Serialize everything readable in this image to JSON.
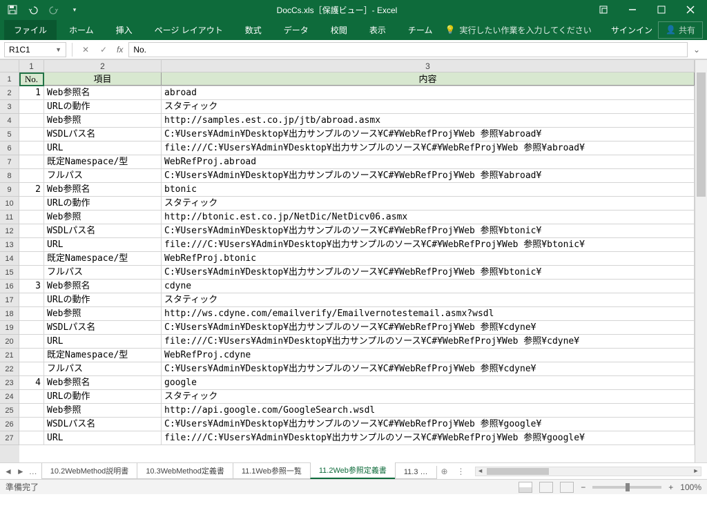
{
  "title": "DocCs.xls［保護ビュー］- Excel",
  "qat": {
    "save": "save",
    "undo": "undo",
    "redo": "redo"
  },
  "tabs": {
    "file": "ファイル",
    "home": "ホーム",
    "insert": "挿入",
    "pagelayout": "ページ レイアウト",
    "formulas": "数式",
    "data": "データ",
    "review": "校閲",
    "view": "表示",
    "team": "チーム"
  },
  "tellme": "実行したい作業を入力してください",
  "signin": "サインイン",
  "share": "共有",
  "namebox": "R1C1",
  "formula": "No.",
  "colHeaders": [
    "1",
    "2",
    "3"
  ],
  "headerRow": {
    "c1": "No.",
    "c2": "項目",
    "c3": "内容"
  },
  "rows": [
    {
      "n": "1",
      "c1": "1",
      "c2": "Web参照名",
      "c3": "abroad"
    },
    {
      "n": "2",
      "c1": "",
      "c2": "URLの動作",
      "c3": "スタティック"
    },
    {
      "n": "3",
      "c1": "",
      "c2": "Web参照",
      "c3": "http://samples.est.co.jp/jtb/abroad.asmx"
    },
    {
      "n": "4",
      "c1": "",
      "c2": "WSDLパス名",
      "c3": "C:¥Users¥Admin¥Desktop¥出力サンプルのソース¥C#¥WebRefProj¥Web 参照¥abroad¥"
    },
    {
      "n": "5",
      "c1": "",
      "c2": "URL",
      "c3": "file:///C:¥Users¥Admin¥Desktop¥出力サンプルのソース¥C#¥WebRefProj¥Web 参照¥abroad¥"
    },
    {
      "n": "6",
      "c1": "",
      "c2": "既定Namespace/型",
      "c3": "WebRefProj.abroad"
    },
    {
      "n": "7",
      "c1": "",
      "c2": "フルパス",
      "c3": "C:¥Users¥Admin¥Desktop¥出力サンプルのソース¥C#¥WebRefProj¥Web 参照¥abroad¥"
    },
    {
      "n": "8",
      "c1": "2",
      "c2": "Web参照名",
      "c3": "btonic"
    },
    {
      "n": "9",
      "c1": "",
      "c2": "URLの動作",
      "c3": "スタティック"
    },
    {
      "n": "10",
      "c1": "",
      "c2": "Web参照",
      "c3": "http://btonic.est.co.jp/NetDic/NetDicv06.asmx"
    },
    {
      "n": "11",
      "c1": "",
      "c2": "WSDLパス名",
      "c3": "C:¥Users¥Admin¥Desktop¥出力サンプルのソース¥C#¥WebRefProj¥Web 参照¥btonic¥"
    },
    {
      "n": "12",
      "c1": "",
      "c2": "URL",
      "c3": "file:///C:¥Users¥Admin¥Desktop¥出力サンプルのソース¥C#¥WebRefProj¥Web 参照¥btonic¥"
    },
    {
      "n": "13",
      "c1": "",
      "c2": "既定Namespace/型",
      "c3": "WebRefProj.btonic"
    },
    {
      "n": "14",
      "c1": "",
      "c2": "フルパス",
      "c3": "C:¥Users¥Admin¥Desktop¥出力サンプルのソース¥C#¥WebRefProj¥Web 参照¥btonic¥"
    },
    {
      "n": "15",
      "c1": "3",
      "c2": "Web参照名",
      "c3": "cdyne"
    },
    {
      "n": "16",
      "c1": "",
      "c2": "URLの動作",
      "c3": "スタティック"
    },
    {
      "n": "17",
      "c1": "",
      "c2": "Web参照",
      "c3": "http://ws.cdyne.com/emailverify/Emailvernotestemail.asmx?wsdl"
    },
    {
      "n": "18",
      "c1": "",
      "c2": "WSDLパス名",
      "c3": "C:¥Users¥Admin¥Desktop¥出力サンプルのソース¥C#¥WebRefProj¥Web 参照¥cdyne¥"
    },
    {
      "n": "19",
      "c1": "",
      "c2": "URL",
      "c3": "file:///C:¥Users¥Admin¥Desktop¥出力サンプルのソース¥C#¥WebRefProj¥Web 参照¥cdyne¥"
    },
    {
      "n": "20",
      "c1": "",
      "c2": "既定Namespace/型",
      "c3": "WebRefProj.cdyne"
    },
    {
      "n": "21",
      "c1": "",
      "c2": "フルパス",
      "c3": "C:¥Users¥Admin¥Desktop¥出力サンプルのソース¥C#¥WebRefProj¥Web 参照¥cdyne¥"
    },
    {
      "n": "22",
      "c1": "4",
      "c2": "Web参照名",
      "c3": "google"
    },
    {
      "n": "23",
      "c1": "",
      "c2": "URLの動作",
      "c3": "スタティック"
    },
    {
      "n": "24",
      "c1": "",
      "c2": "Web参照",
      "c3": "http://api.google.com/GoogleSearch.wsdl"
    },
    {
      "n": "25",
      "c1": "",
      "c2": "WSDLパス名",
      "c3": "C:¥Users¥Admin¥Desktop¥出力サンプルのソース¥C#¥WebRefProj¥Web 参照¥google¥"
    },
    {
      "n": "26",
      "c1": "",
      "c2": "URL",
      "c3": "file:///C:¥Users¥Admin¥Desktop¥出力サンプルのソース¥C#¥WebRefProj¥Web 参照¥google¥"
    }
  ],
  "sheets": {
    "more": "…",
    "s1": "10.2WebMethod説明書",
    "s2": "10.3WebMethod定義書",
    "s3": "11.1Web参照一覧",
    "s4": "11.2Web参照定義書",
    "s5": "11.3 …"
  },
  "status": "準備完了",
  "zoom": "100%"
}
